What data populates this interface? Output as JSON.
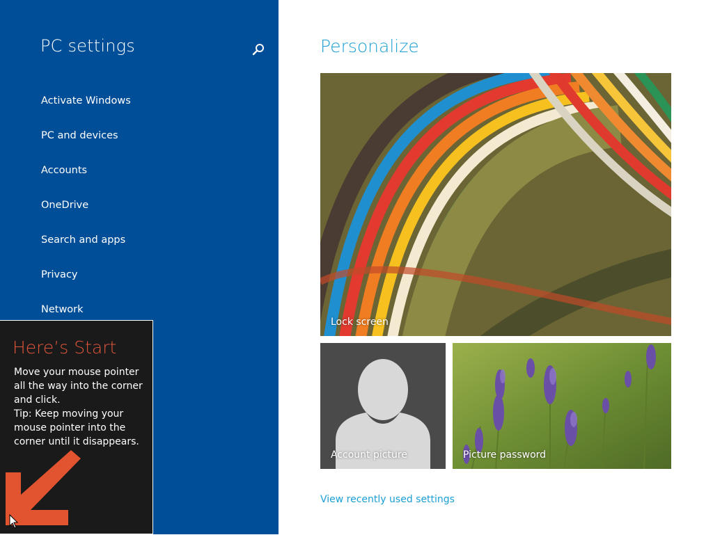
{
  "colors": {
    "pane_bg": "#004e98",
    "accent": "#1a9fd4",
    "tip_title": "#e0553a",
    "arrow": "#e2542f"
  },
  "sidebar": {
    "title": "PC settings",
    "search_icon": "search-icon",
    "items": [
      {
        "label": "Activate Windows"
      },
      {
        "label": "PC and devices"
      },
      {
        "label": "Accounts"
      },
      {
        "label": "OneDrive"
      },
      {
        "label": "Search and apps"
      },
      {
        "label": "Privacy"
      },
      {
        "label": "Network"
      }
    ]
  },
  "main": {
    "title": "Personalize",
    "tiles": {
      "lock_screen": {
        "label": "Lock screen"
      },
      "account_picture": {
        "label": "Account picture"
      },
      "picture_password": {
        "label": "Picture password"
      }
    },
    "recent_link": "View recently used settings"
  },
  "start_tip": {
    "title": "Here’s Start",
    "body": "Move your mouse pointer all the way into the corner and click.\nTip: Keep moving your mouse pointer into the corner until it disappears.",
    "arrow_icon": "arrow-down-left-icon"
  }
}
